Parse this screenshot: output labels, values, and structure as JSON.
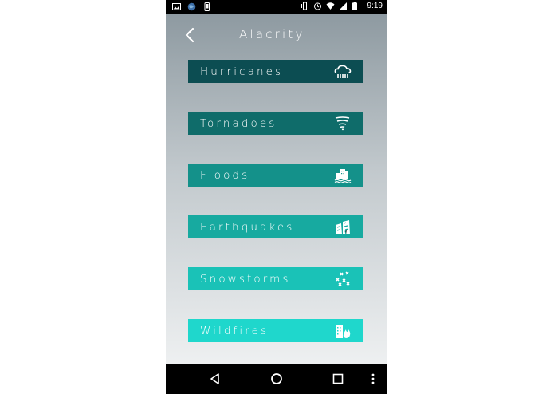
{
  "status_bar": {
    "time": "9:19",
    "left_icons": [
      "image-icon",
      "globe-icon",
      "phone-icon"
    ],
    "right_icons": [
      "vibrate-icon",
      "alarm-icon",
      "wifi-icon",
      "signal-icon",
      "battery-icon"
    ]
  },
  "app": {
    "title": "Alacrity",
    "back_icon": "back-chevron-icon"
  },
  "menu": [
    {
      "label": "Hurricanes",
      "icon": "hurricane-cloud-icon",
      "color": "#0c4d52"
    },
    {
      "label": "Tornadoes",
      "icon": "tornado-icon",
      "color": "#0f6c6a"
    },
    {
      "label": "Floods",
      "icon": "flood-building-icon",
      "color": "#14918a"
    },
    {
      "label": "Earthquakes",
      "icon": "earthquake-building-icon",
      "color": "#17aaa0"
    },
    {
      "label": "Snowstorms",
      "icon": "snowflakes-icon",
      "color": "#1ac2b7"
    },
    {
      "label": "Wildfires",
      "icon": "wildfire-building-icon",
      "color": "#1fd7cc"
    }
  ],
  "nav_bar": {
    "back": "nav-back-icon",
    "home": "nav-home-icon",
    "recents": "nav-recents-icon",
    "more": "nav-more-icon"
  }
}
